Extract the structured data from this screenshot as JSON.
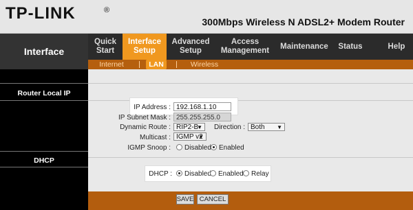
{
  "header": {
    "logo": "TP-LINK",
    "logo_mark": "®",
    "model": "300Mbps Wireless N ADSL2+ Modem Router"
  },
  "sidebar": {
    "title": "Interface",
    "sections": [
      "Router Local IP",
      "DHCP"
    ]
  },
  "nav": {
    "tabs": [
      {
        "line1": "Quick",
        "line2": "Start"
      },
      {
        "line1": "Interface",
        "line2": "Setup"
      },
      {
        "line1": "Advanced",
        "line2": "Setup"
      },
      {
        "line1": "Access",
        "line2": "Management"
      },
      {
        "line1": "Maintenance",
        "line2": ""
      },
      {
        "line1": "Status",
        "line2": ""
      },
      {
        "line1": "Help",
        "line2": ""
      }
    ],
    "subtabs": [
      "Internet",
      "LAN",
      "Wireless"
    ]
  },
  "router_ip": {
    "ip_label": "IP Address :",
    "ip_value": "192.168.1.10",
    "mask_label": "IP Subnet Mask :",
    "mask_value": "255.255.255.0",
    "dyn_label": "Dynamic Route :",
    "dyn_value": "RIP2-B",
    "dir_label": "Direction :",
    "dir_value": "Both",
    "mcast_label": "Multicast :",
    "mcast_value": "IGMP v2",
    "igmp_label": "IGMP Snoop :",
    "igmp_disabled": "Disabled",
    "igmp_enabled": "Enabled"
  },
  "dhcp": {
    "label": "DHCP :",
    "disabled": "Disabled",
    "enabled": "Enabled",
    "relay": "Relay"
  },
  "footer": {
    "save": "SAVE",
    "cancel": "CANCEL"
  }
}
